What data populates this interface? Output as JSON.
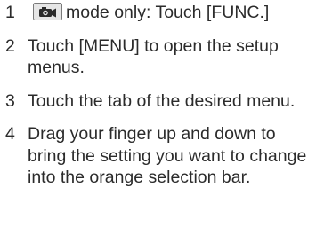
{
  "steps": [
    {
      "number": "1",
      "icon": "camera-mode-icon",
      "text": "mode only: Touch [FUNC.]"
    },
    {
      "number": "2",
      "text": "Touch [MENU] to open the setup menus."
    },
    {
      "number": "3",
      "text": "Touch the tab of the desired menu."
    },
    {
      "number": "4",
      "text": "Drag your finger up and down to bring the setting you want to change into the orange selection bar."
    }
  ]
}
